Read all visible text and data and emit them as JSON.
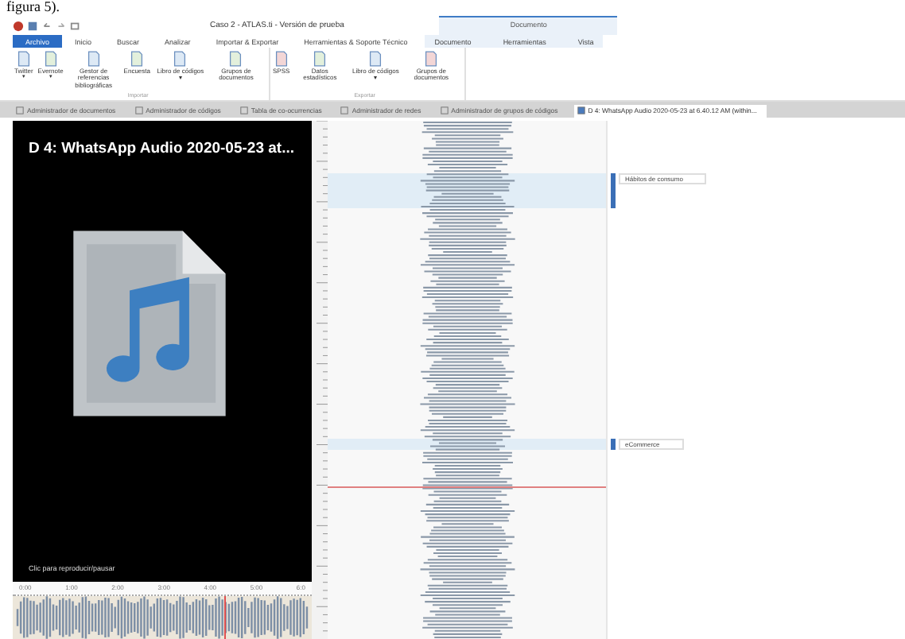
{
  "caption": "figura 5).",
  "window": {
    "title": "Caso 2 - ATLAS.ti - Versión de prueba",
    "context_group": "Documento"
  },
  "ribbon_tabs": [
    {
      "label": "Archivo",
      "selected": true,
      "kind": "file"
    },
    {
      "label": "Inicio",
      "selected": false,
      "kind": "main"
    },
    {
      "label": "Buscar",
      "selected": false,
      "kind": "main"
    },
    {
      "label": "Analizar",
      "selected": false,
      "kind": "main"
    },
    {
      "label": "Importar & Exportar",
      "selected": false,
      "kind": "main"
    },
    {
      "label": "Herramientas & Soporte Técnico",
      "selected": false,
      "kind": "main"
    },
    {
      "label": "Documento",
      "selected": false,
      "kind": "context"
    },
    {
      "label": "Herramientas",
      "selected": false,
      "kind": "context"
    },
    {
      "label": "Vista",
      "selected": false,
      "kind": "context"
    }
  ],
  "ribbon_groups": [
    {
      "label": "Importar",
      "buttons": [
        {
          "label": "Twitter",
          "caret": "▾"
        },
        {
          "label": "Evernote",
          "caret": "▾"
        },
        {
          "label": "Gestor de referencias bibliográficas"
        },
        {
          "label": "Encuesta"
        },
        {
          "label": "Libro de códigos ▾"
        },
        {
          "label": "Grupos de documentos"
        }
      ]
    },
    {
      "label": "Exportar",
      "buttons": [
        {
          "label": "SPSS"
        },
        {
          "label": "Datos estadísticos"
        },
        {
          "label": "Libro de códigos ▾"
        },
        {
          "label": "Grupos de documentos"
        }
      ]
    }
  ],
  "doc_tabs": [
    {
      "label": "Administrador de documentos",
      "selected": false
    },
    {
      "label": "Administrador de códigos",
      "selected": false
    },
    {
      "label": "Tabla de co-ocurrencias",
      "selected": false
    },
    {
      "label": "Administrador de redes",
      "selected": false
    },
    {
      "label": "Administrador de grupos de códigos",
      "selected": false
    },
    {
      "label": "D 4: WhatsApp Audio 2020-05-23 at 6.40.12 AM (within...",
      "selected": true
    }
  ],
  "player": {
    "title": "D 4: WhatsApp Audio 2020-05-23 at...",
    "hint": "Clic para reproducir/pausar",
    "timeline": [
      "0:00",
      "1:00",
      "2:00",
      "3:00",
      "4:00",
      "5:00",
      "6:0"
    ]
  },
  "codes": [
    {
      "label": "Hábitos de consumo"
    },
    {
      "label": "eCommerce"
    }
  ]
}
